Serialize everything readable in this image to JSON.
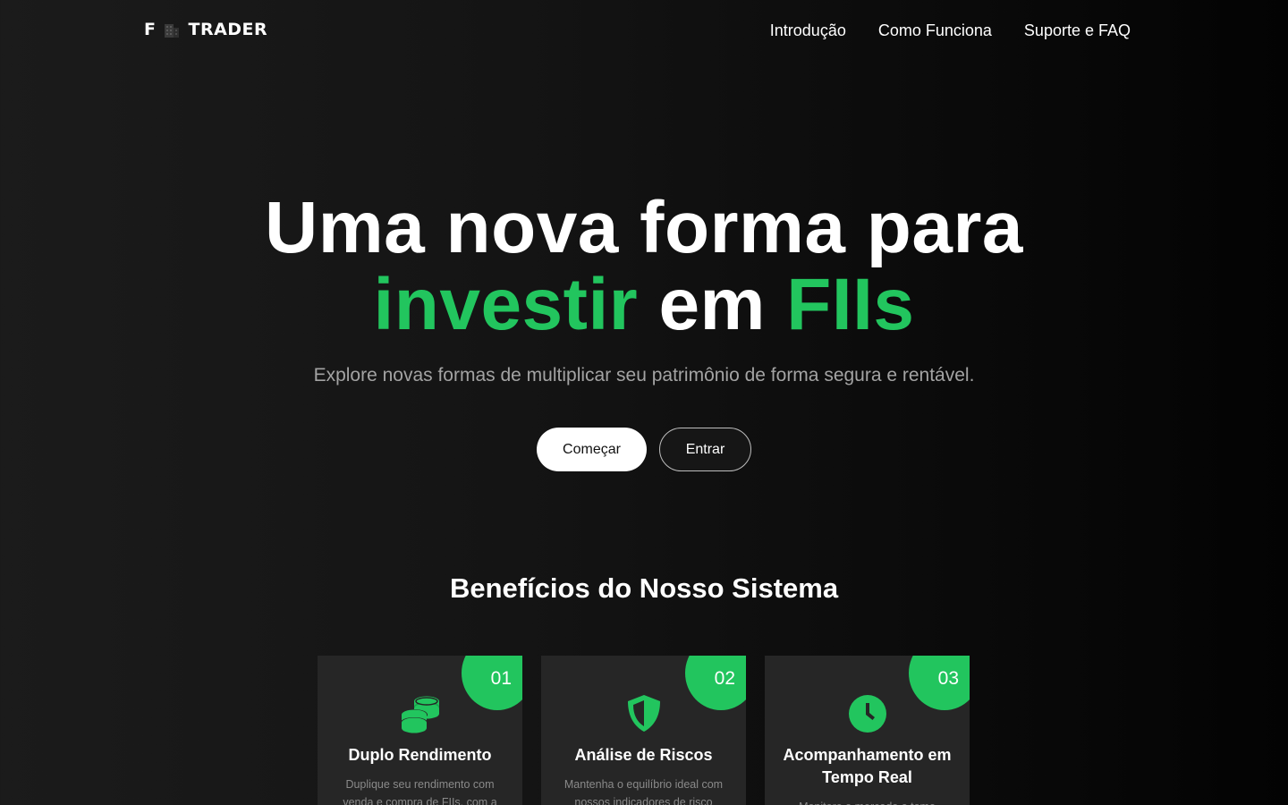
{
  "brand": {
    "letter": "F",
    "name": "TRADER",
    "icon": "building-icon"
  },
  "nav": {
    "links": [
      "Introdução",
      "Como Funciona",
      "Suporte e FAQ"
    ]
  },
  "hero": {
    "title_line1": "Uma nova forma para",
    "title_word1": "investir",
    "title_word2": "em",
    "title_word3": "FIIs",
    "subtitle": "Explore novas formas de multiplicar seu patrimônio de forma segura e rentável.",
    "primary_cta": "Começar",
    "secondary_cta": "Entrar"
  },
  "benefits": {
    "title": "Benefícios do Nosso Sistema",
    "cards": [
      {
        "number": "01",
        "icon": "coins-icon",
        "title": "Duplo Rendimento",
        "desc": "Duplique seu rendimento com venda e compra de FIIs, com a"
      },
      {
        "number": "02",
        "icon": "shield-icon",
        "title": "Análise de Riscos",
        "desc": "Mantenha o equilíbrio ideal com nossos indicadores de risco"
      },
      {
        "number": "03",
        "icon": "clock-icon",
        "title": "Acompanhamento em Tempo Real",
        "desc": "Monitore o mercado e tome"
      }
    ]
  },
  "colors": {
    "accent": "#22c55e",
    "card_bg": "#262626",
    "muted_text": "#a3a3a3"
  }
}
